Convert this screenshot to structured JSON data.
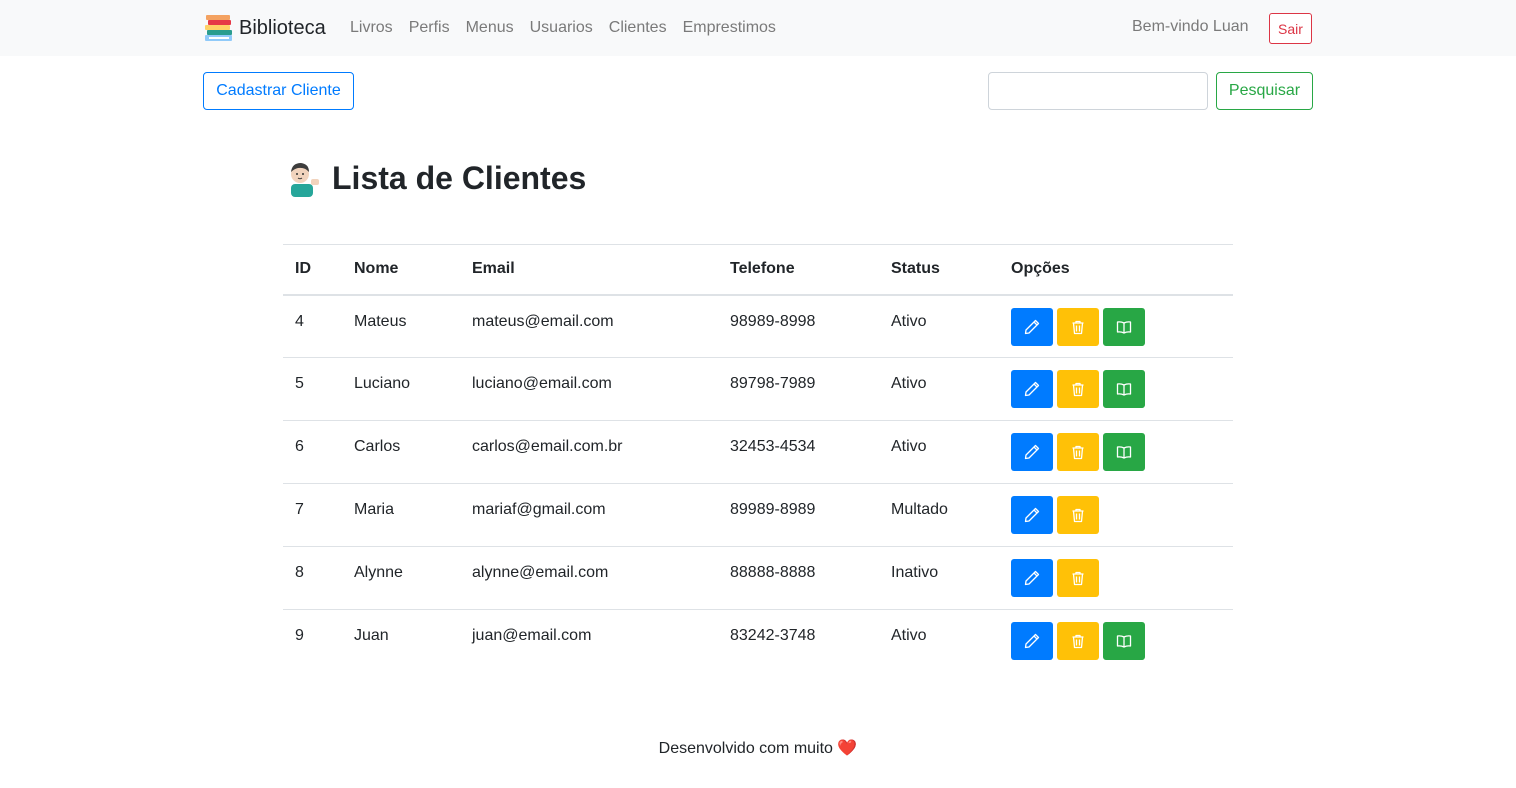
{
  "nav": {
    "brand": "Biblioteca",
    "links": [
      "Livros",
      "Perfis",
      "Menus",
      "Usuarios",
      "Clientes",
      "Emprestimos"
    ],
    "welcome": "Bem-vindo Luan",
    "logout": "Sair"
  },
  "toolbar": {
    "new_client": "Cadastrar Cliente",
    "search_value": "",
    "search_button": "Pesquisar"
  },
  "page": {
    "title": "Lista de Clientes"
  },
  "table": {
    "headers": [
      "ID",
      "Nome",
      "Email",
      "Telefone",
      "Status",
      "Opções"
    ],
    "rows": [
      {
        "id": "4",
        "nome": "Mateus",
        "email": "mateus@email.com",
        "telefone": "98989-8998",
        "status": "Ativo"
      },
      {
        "id": "5",
        "nome": "Luciano",
        "email": "luciano@email.com",
        "telefone": "89798-7989",
        "status": "Ativo"
      },
      {
        "id": "6",
        "nome": "Carlos",
        "email": "carlos@email.com.br",
        "telefone": "32453-4534",
        "status": "Ativo"
      },
      {
        "id": "7",
        "nome": "Maria",
        "email": "mariaf@gmail.com",
        "telefone": "89989-8989",
        "status": "Multado"
      },
      {
        "id": "8",
        "nome": "Alynne",
        "email": "alynne@email.com",
        "telefone": "88888-8888",
        "status": "Inativo"
      },
      {
        "id": "9",
        "nome": "Juan",
        "email": "juan@email.com",
        "telefone": "83242-3748",
        "status": "Ativo"
      }
    ]
  },
  "footer": {
    "text": "Desenvolvido com muito",
    "heart": "❤️"
  },
  "colors": {
    "primary": "#007bff",
    "warning": "#ffc107",
    "success": "#28a745",
    "danger": "#dc3545"
  }
}
